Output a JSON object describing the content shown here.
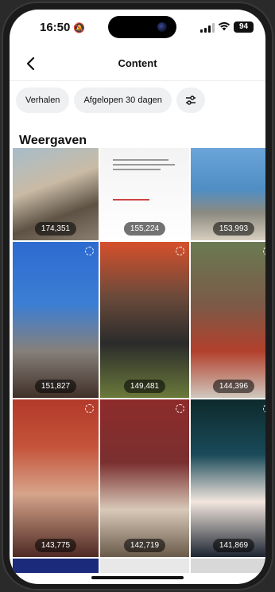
{
  "status_bar": {
    "time": "16:50",
    "battery": "94"
  },
  "nav": {
    "title": "Content"
  },
  "filters": {
    "stories_label": "Verhalen",
    "range_label": "Afgelopen 30 dagen"
  },
  "section": {
    "title": "Weergaven"
  },
  "tiles": [
    {
      "views": "174,351"
    },
    {
      "views": "155,224"
    },
    {
      "views": "153,993"
    },
    {
      "views": "151,827"
    },
    {
      "views": "149,481"
    },
    {
      "views": "144,396"
    },
    {
      "views": "143,775"
    },
    {
      "views": "142,719"
    },
    {
      "views": "141,869"
    }
  ],
  "icons": {
    "back": "chevron-left-icon",
    "filter": "sliders-icon",
    "mute": "bell-off-icon",
    "wifi": "wifi-icon",
    "reel": "reel-icon"
  }
}
